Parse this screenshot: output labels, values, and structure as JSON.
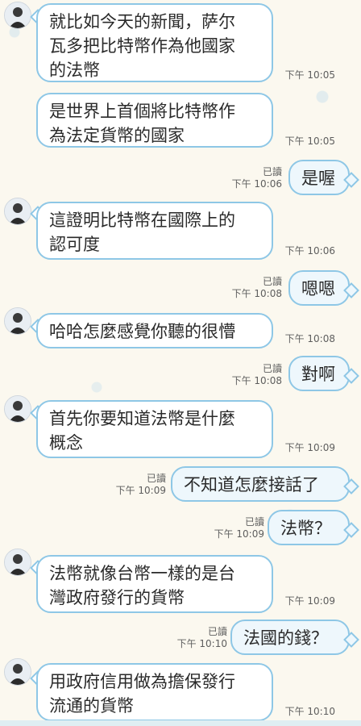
{
  "chat": {
    "messages": [
      {
        "side": "in",
        "text": "就比如今天的新聞，萨尔\n瓦多把比特幣作為他國家\n的法幣",
        "time": "下午 10:05"
      },
      {
        "side": "in",
        "text": "是世界上首個將比特幣作\n為法定貨幣的國家",
        "time": "下午 10:05"
      },
      {
        "side": "out",
        "text": "是喔",
        "read": "已讀",
        "time": "下午 10:06"
      },
      {
        "side": "in",
        "text": "這證明比特幣在國際上的\n認可度",
        "time": "下午 10:06"
      },
      {
        "side": "out",
        "text": "嗯嗯",
        "read": "已讀",
        "time": "下午 10:08"
      },
      {
        "side": "in",
        "text": "哈哈怎麼感覺你聽的很懵",
        "time": "下午 10:08"
      },
      {
        "side": "out",
        "text": "對啊",
        "read": "已讀",
        "time": "下午 10:08"
      },
      {
        "side": "in",
        "text": "首先你要知道法幣是什麼\n概念",
        "time": "下午 10:09"
      },
      {
        "side": "out",
        "text": "不知道怎麼接話了",
        "read": "已讀",
        "time": "下午 10:09"
      },
      {
        "side": "out",
        "text": "法幣？",
        "read": "已讀",
        "time": "下午 10:09"
      },
      {
        "side": "in",
        "text": "法幣就像台幣一樣的是台\n灣政府發行的貨幣",
        "time": "下午 10:09"
      },
      {
        "side": "out",
        "text": "法國的錢？",
        "read": "已讀",
        "time": "下午 10:10"
      },
      {
        "side": "in",
        "text": "用政府信用做為擔保發行\n流通的貨幣",
        "time": "下午 10:10"
      }
    ]
  }
}
